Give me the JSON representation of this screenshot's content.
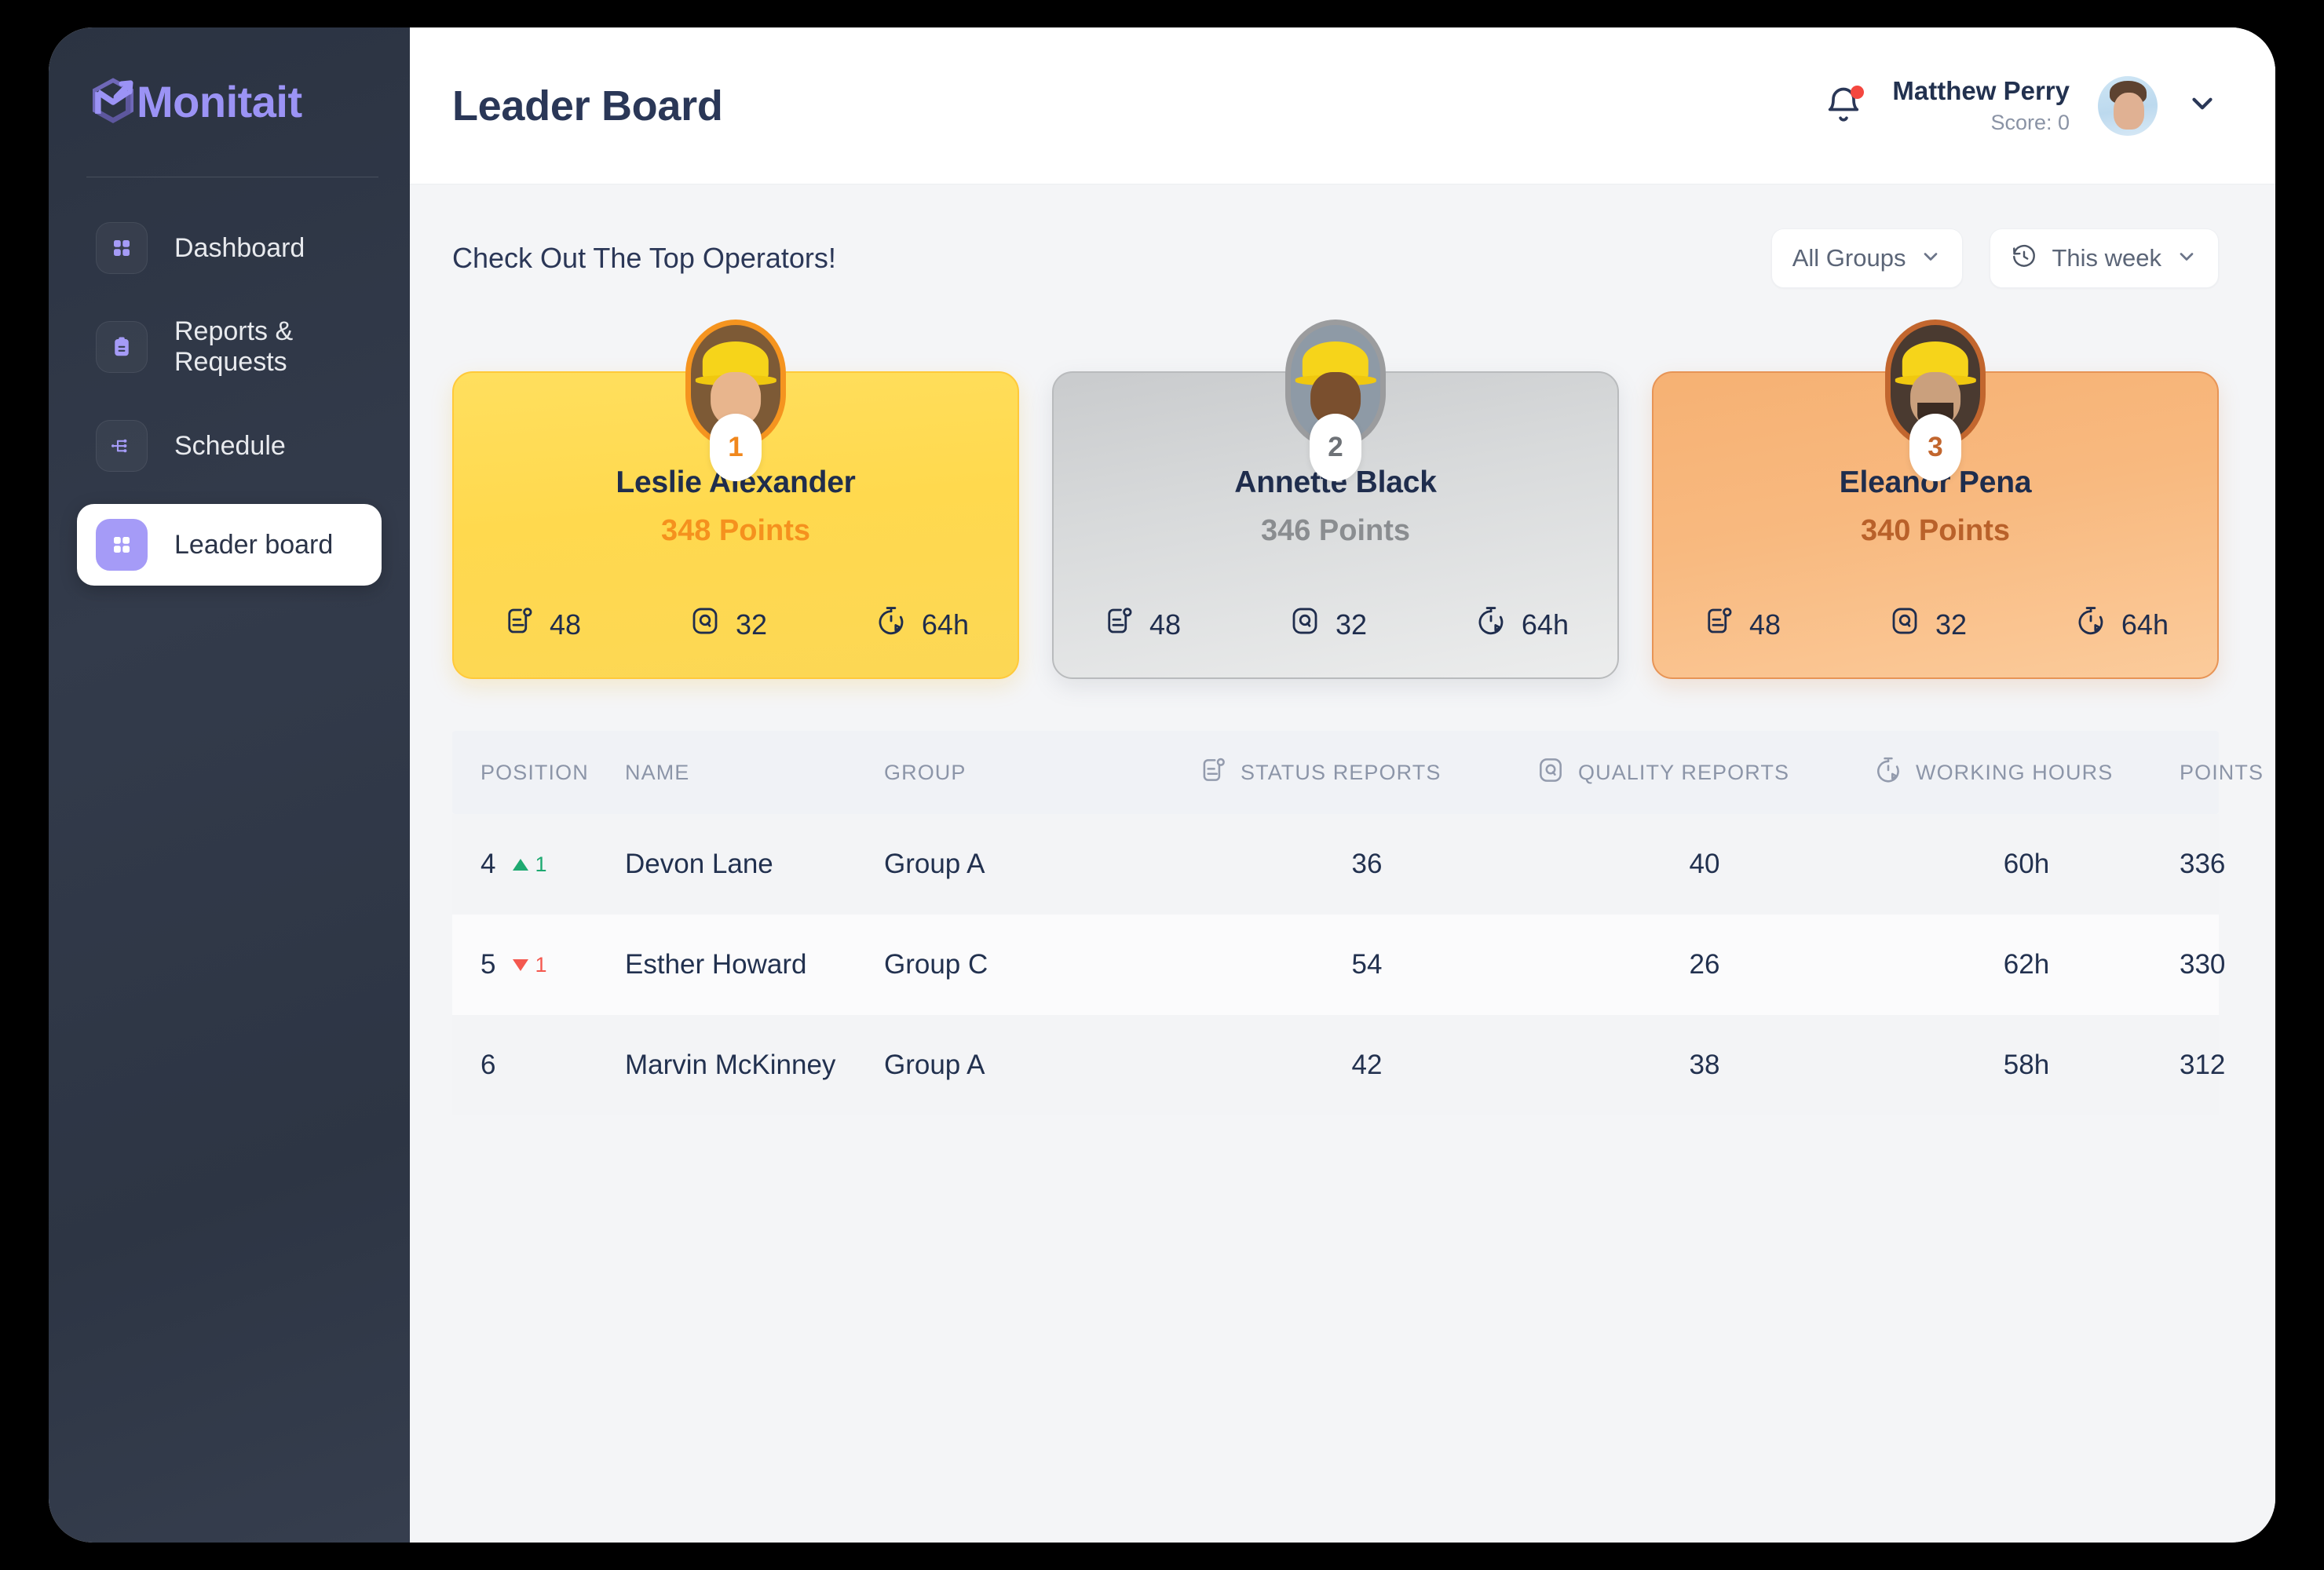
{
  "brand": {
    "name": "Monitait",
    "accent": "#9b93f5",
    "logo_icon": "monitait-logo-icon"
  },
  "sidebar": {
    "items": [
      {
        "label": "Dashboard",
        "icon": "grid-icon",
        "active": false
      },
      {
        "label": "Reports & Requests",
        "icon": "clipboard-icon",
        "active": false
      },
      {
        "label": "Schedule",
        "icon": "flow-branch-icon",
        "active": false
      },
      {
        "label": "Leader board",
        "icon": "grid-icon",
        "active": true
      }
    ]
  },
  "topbar": {
    "title": "Leader Board",
    "notification_icon": "bell-icon",
    "has_notification_dot": true,
    "user": {
      "name": "Matthew Perry",
      "score_label": "Score: 0",
      "avatar": "user-avatar"
    },
    "chevron_icon": "chevron-down-icon"
  },
  "content": {
    "section_title": "Check Out The Top Operators!",
    "filters": [
      {
        "label": "All Groups",
        "icon": null,
        "chevron": "chevron-down-icon"
      },
      {
        "label": "This week",
        "icon": "history-clock-icon",
        "chevron": "chevron-down-icon"
      }
    ]
  },
  "podium": [
    {
      "rank": "1",
      "tier": "gold",
      "name": "Leslie Alexander",
      "points": "348 Points",
      "status_reports": "48",
      "quality_reports": "32",
      "working_hours": "64h",
      "card_color": "#ffd94e",
      "accent": "#f5911e"
    },
    {
      "rank": "2",
      "tier": "silver",
      "name": "Annette Black",
      "points": "346 Points",
      "status_reports": "48",
      "quality_reports": "32",
      "working_hours": "64h",
      "card_color": "#d8dadb",
      "accent": "#8a8d90"
    },
    {
      "rank": "3",
      "tier": "bronze",
      "name": "Eleanor Pena",
      "points": "340 Points",
      "status_reports": "48",
      "quality_reports": "32",
      "working_hours": "64h",
      "card_color": "#f8b97f",
      "accent": "#b9612a"
    }
  ],
  "table": {
    "columns": [
      {
        "key": "position",
        "label": "POSITION",
        "icon": null
      },
      {
        "key": "name",
        "label": "NAME",
        "icon": null
      },
      {
        "key": "group",
        "label": "GROUP",
        "icon": null
      },
      {
        "key": "status_reports",
        "label": "STATUS REPORTS",
        "icon": "status-report-icon"
      },
      {
        "key": "quality_reports",
        "label": "QUALITY REPORTS",
        "icon": "quality-report-icon"
      },
      {
        "key": "working_hours",
        "label": "WORKING HOURS",
        "icon": "stopwatch-icon"
      },
      {
        "key": "points",
        "label": "POINTS",
        "icon": null
      }
    ],
    "rows": [
      {
        "position": "4",
        "delta_dir": "up",
        "delta_value": "1",
        "name": "Devon Lane",
        "group": "Group A",
        "status_reports": "36",
        "quality_reports": "40",
        "working_hours": "60h",
        "points": "336"
      },
      {
        "position": "5",
        "delta_dir": "down",
        "delta_value": "1",
        "name": "Esther Howard",
        "group": "Group C",
        "status_reports": "54",
        "quality_reports": "26",
        "working_hours": "62h",
        "points": "330"
      },
      {
        "position": "6",
        "delta_dir": null,
        "delta_value": "",
        "name": "Marvin McKinney",
        "group": "Group A",
        "status_reports": "42",
        "quality_reports": "38",
        "working_hours": "58h",
        "points": "312"
      }
    ]
  }
}
